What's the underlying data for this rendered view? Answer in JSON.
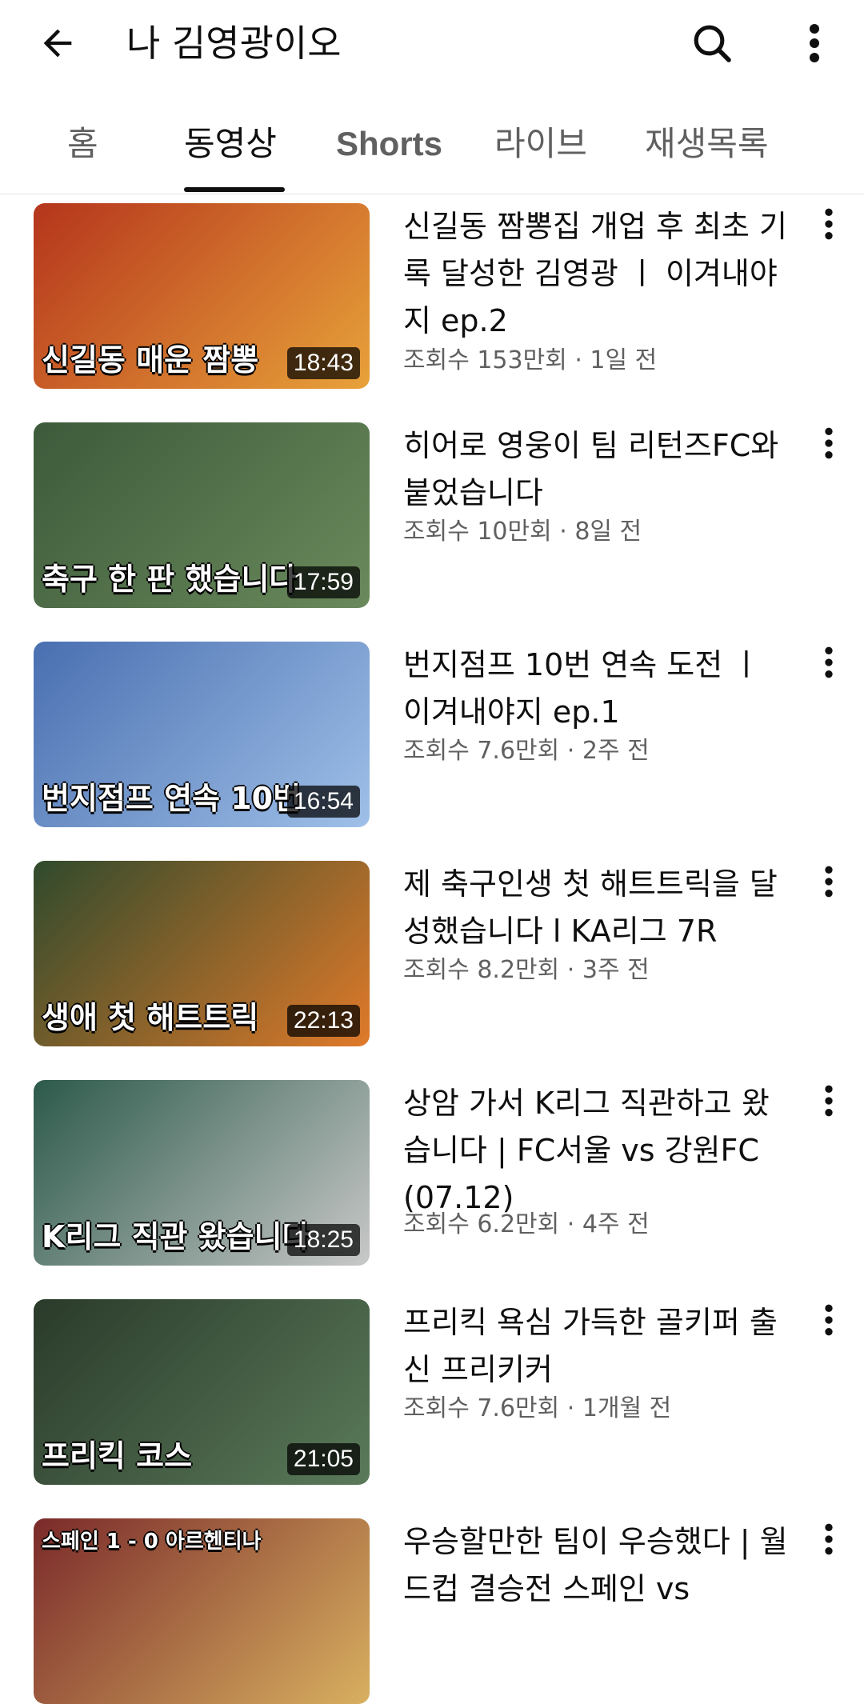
{
  "header": {
    "title": "나 김영광이오",
    "back_icon": "arrow-left-icon",
    "search_icon": "search-icon",
    "more_icon": "more-vert-icon"
  },
  "tabs": [
    {
      "label": "홈",
      "active": false
    },
    {
      "label": "동영상",
      "active": true
    },
    {
      "label": "Shorts",
      "active": false
    },
    {
      "label": "라이브",
      "active": false
    },
    {
      "label": "재생목록",
      "active": false
    }
  ],
  "videos": [
    {
      "title": "신길동 짬뽕집 개업 후 최초 기록 달성한 김영광 ㅣ 이겨내야지 ep.2",
      "meta": "조회수 153만회 · 1일 전",
      "duration": "18:43",
      "thumb_caption": "신길동 매운 짬뽕",
      "thumb_colors": [
        "#b5351c",
        "#e8a23a"
      ]
    },
    {
      "title": "히어로 영웅이 팀 리턴즈FC와 붙었습니다",
      "meta": "조회수 10만회 · 8일 전",
      "duration": "17:59",
      "thumb_caption": "축구 한 판 했습니다",
      "thumb_colors": [
        "#3d5a3a",
        "#6a8a5c"
      ]
    },
    {
      "title": "번지점프 10번 연속 도전 ㅣ 이겨내야지 ep.1",
      "meta": "조회수 7.6만회 · 2주 전",
      "duration": "16:54",
      "thumb_caption": "번지점프 연속 10번",
      "thumb_colors": [
        "#4a6fb0",
        "#9fc0e8"
      ]
    },
    {
      "title": "제 축구인생 첫 해트트릭을 달성했습니다 l KA리그 7R",
      "meta": "조회수 8.2만회 · 3주 전",
      "duration": "22:13",
      "thumb_caption": "생애 첫 해트트릭",
      "thumb_colors": [
        "#2f4a2c",
        "#e07a2a"
      ]
    },
    {
      "title": "상암 가서 K리그 직관하고 왔습니다 | FC서울 vs 강원FC (07.12)",
      "meta": "조회수 6.2만회 · 4주 전",
      "duration": "18:25",
      "thumb_caption": "K리그 직관 왔습니다",
      "thumb_colors": [
        "#2c5a4a",
        "#c8c8c8"
      ]
    },
    {
      "title": "프리킥 욕심 가득한 골키퍼 출신 프리키커",
      "meta": "조회수 7.6만회 · 1개월 전",
      "duration": "21:05",
      "thumb_caption": "프리킥 코스",
      "thumb_colors": [
        "#2a3a2a",
        "#5a7a5a"
      ]
    },
    {
      "title": "우승할만한 팀이 우승했다 | 월드컵 결승전 스페인 vs",
      "meta": "",
      "duration": "",
      "thumb_caption": "스페인 1 - 0 아르헨티나",
      "thumb_colors": [
        "#7a2a2a",
        "#d8b060"
      ]
    }
  ]
}
